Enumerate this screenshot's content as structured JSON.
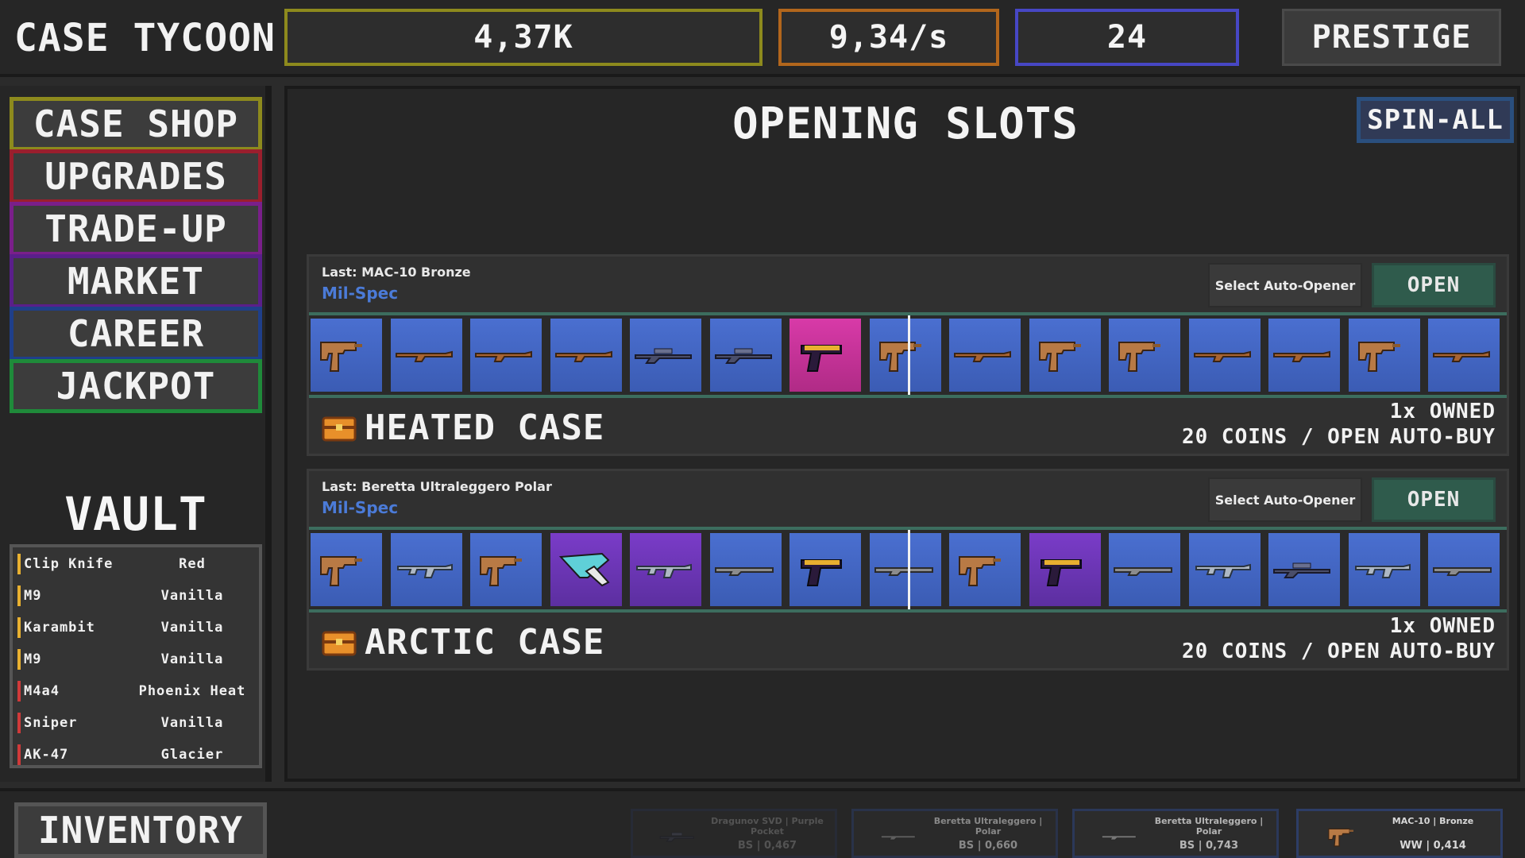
{
  "app": {
    "title": "CASE TYCOON"
  },
  "stats": {
    "money": "4,37K",
    "rate": "9,34/s",
    "level": "24"
  },
  "header": {
    "prestige_label": "PRESTIGE"
  },
  "sidebar": {
    "nav": [
      {
        "label": "CASE SHOP",
        "color": "#8d8a1d"
      },
      {
        "label": "UPGRADES",
        "color": "#9a1f2d"
      },
      {
        "label": "TRADE-UP",
        "color": "#7a1f8a"
      },
      {
        "label": "MARKET",
        "color": "#5a1f8a"
      },
      {
        "label": "CAREER",
        "color": "#1f3f8a"
      },
      {
        "label": "JACKPOT",
        "color": "#1f8a3a"
      }
    ],
    "vault_title": "VAULT",
    "vault_items": [
      {
        "name": "Clip Knife",
        "skin": "Red",
        "color": "#e8b030"
      },
      {
        "name": "M9",
        "skin": "Vanilla",
        "color": "#e8b030"
      },
      {
        "name": "Karambit",
        "skin": "Vanilla",
        "color": "#e8b030"
      },
      {
        "name": "M9",
        "skin": "Vanilla",
        "color": "#e8b030"
      },
      {
        "name": "M4a4",
        "skin": "Phoenix Heat",
        "color": "#d03a3a"
      },
      {
        "name": "Sniper",
        "skin": "Vanilla",
        "color": "#d03a3a"
      },
      {
        "name": "AK-47",
        "skin": "Glacier",
        "color": "#d03a3a"
      }
    ]
  },
  "main": {
    "title": "OPENING SLOTS",
    "spin_all_label": "SPIN-ALL",
    "cases": [
      {
        "last": "Last: MAC-10 Bronze",
        "rarity": "Mil-Spec",
        "auto_opener_label": "Select Auto-Opener",
        "open_label": "OPEN",
        "name": "HEATED CASE",
        "owned": "1x OWNED",
        "price": "20 COINS / OPEN",
        "auto_buy": "AUTO-BUY",
        "slots": [
          {
            "icon": "smg-icon",
            "tier": "blue"
          },
          {
            "icon": "rifle-icon",
            "tier": "blue"
          },
          {
            "icon": "rifle-icon",
            "tier": "blue"
          },
          {
            "icon": "rifle-icon",
            "tier": "blue"
          },
          {
            "icon": "sniper-icon",
            "tier": "blue"
          },
          {
            "icon": "sniper-icon",
            "tier": "blue"
          },
          {
            "icon": "pistol-icon",
            "tier": "pink"
          },
          {
            "icon": "smg-icon",
            "tier": "blue"
          },
          {
            "icon": "rifle-icon",
            "tier": "blue"
          },
          {
            "icon": "smg-icon",
            "tier": "blue"
          },
          {
            "icon": "smg-icon",
            "tier": "blue"
          },
          {
            "icon": "rifle-icon",
            "tier": "blue"
          },
          {
            "icon": "rifle-icon",
            "tier": "blue"
          },
          {
            "icon": "smg-icon",
            "tier": "blue"
          },
          {
            "icon": "rifle-icon",
            "tier": "blue"
          }
        ]
      },
      {
        "last": "Last: Beretta Ultraleggero Polar",
        "rarity": "Mil-Spec",
        "auto_opener_label": "Select Auto-Opener",
        "open_label": "OPEN",
        "name": "ARCTIC CASE",
        "owned": "1x OWNED",
        "price": "20 COINS / OPEN",
        "auto_buy": "AUTO-BUY",
        "slots": [
          {
            "icon": "smg-icon",
            "tier": "blue"
          },
          {
            "icon": "assault-rifle-icon",
            "tier": "blue"
          },
          {
            "icon": "smg-icon",
            "tier": "blue"
          },
          {
            "icon": "knife-icon",
            "tier": "purple"
          },
          {
            "icon": "assault-rifle-icon",
            "tier": "purple"
          },
          {
            "icon": "shotgun-icon",
            "tier": "blue"
          },
          {
            "icon": "pistol-icon",
            "tier": "blue"
          },
          {
            "icon": "shotgun-icon",
            "tier": "blue"
          },
          {
            "icon": "smg-icon",
            "tier": "blue"
          },
          {
            "icon": "pistol-icon",
            "tier": "purple"
          },
          {
            "icon": "shotgun-icon",
            "tier": "blue"
          },
          {
            "icon": "assault-rifle-icon",
            "tier": "blue"
          },
          {
            "icon": "sniper-icon",
            "tier": "blue"
          },
          {
            "icon": "assault-rifle-icon",
            "tier": "blue"
          },
          {
            "icon": "shotgun-icon",
            "tier": "blue"
          }
        ]
      }
    ]
  },
  "bottom": {
    "inventory_label": "INVENTORY",
    "recent": [
      {
        "name": "Dragunov SVD | Purple Pocket",
        "wear": "BS | 0,467",
        "icon": "sniper-icon"
      },
      {
        "name": "Beretta Ultraleggero | Polar",
        "wear": "BS | 0,660",
        "icon": "shotgun-icon"
      },
      {
        "name": "Beretta Ultraleggero | Polar",
        "wear": "BS | 0,743",
        "icon": "shotgun-icon"
      },
      {
        "name": "MAC-10 | Bronze",
        "wear": "WW | 0,414",
        "icon": "smg-icon"
      }
    ]
  }
}
